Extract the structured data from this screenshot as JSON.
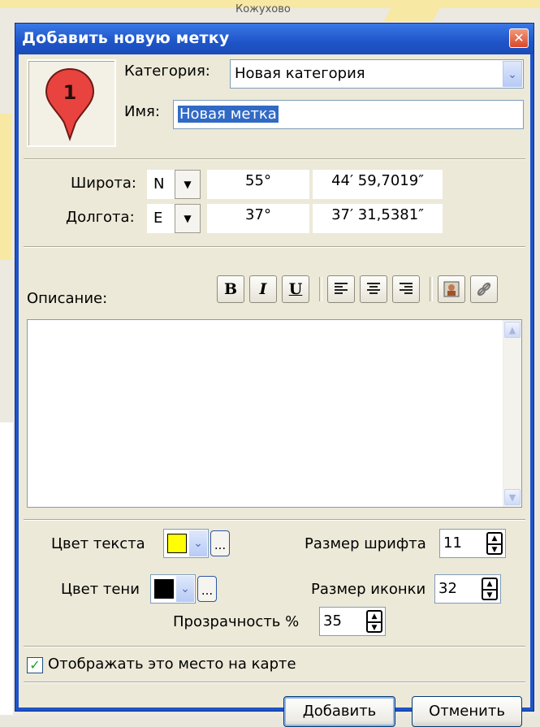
{
  "dialog": {
    "title": "Добавить новую метку",
    "close_glyph": "✕"
  },
  "marker": {
    "number": "1",
    "icon": "map-pin-icon",
    "color": "#e8433f"
  },
  "category": {
    "label": "Категория:",
    "value": "Новая категория"
  },
  "name": {
    "label": "Имя:",
    "value": "Новая метка"
  },
  "latitude": {
    "label": "Широта:",
    "hemisphere": "N",
    "degrees": "55°",
    "minutes_seconds": "44′ 59,7019″"
  },
  "longitude": {
    "label": "Долгота:",
    "hemisphere": "E",
    "degrees": "37°",
    "minutes_seconds": "37′ 31,5381″"
  },
  "description": {
    "label": "Описание:",
    "toolbar": {
      "bold": "B",
      "italic": "I",
      "underline": "U"
    },
    "text": ""
  },
  "text_color": {
    "label": "Цвет текста",
    "color": "#ffff00",
    "more": "..."
  },
  "shadow_color": {
    "label": "Цвет тени",
    "color": "#000000",
    "more": "..."
  },
  "font_size": {
    "label": "Размер шрифта",
    "value": "11"
  },
  "icon_size": {
    "label": "Размер иконки",
    "value": "32"
  },
  "opacity": {
    "label": "Прозрачность %",
    "value": "35"
  },
  "show_on_map": {
    "label": "Отображать это место на карте",
    "checked": true
  },
  "buttons": {
    "add": "Добавить",
    "cancel": "Отменить"
  },
  "map_label": "Кожухово"
}
